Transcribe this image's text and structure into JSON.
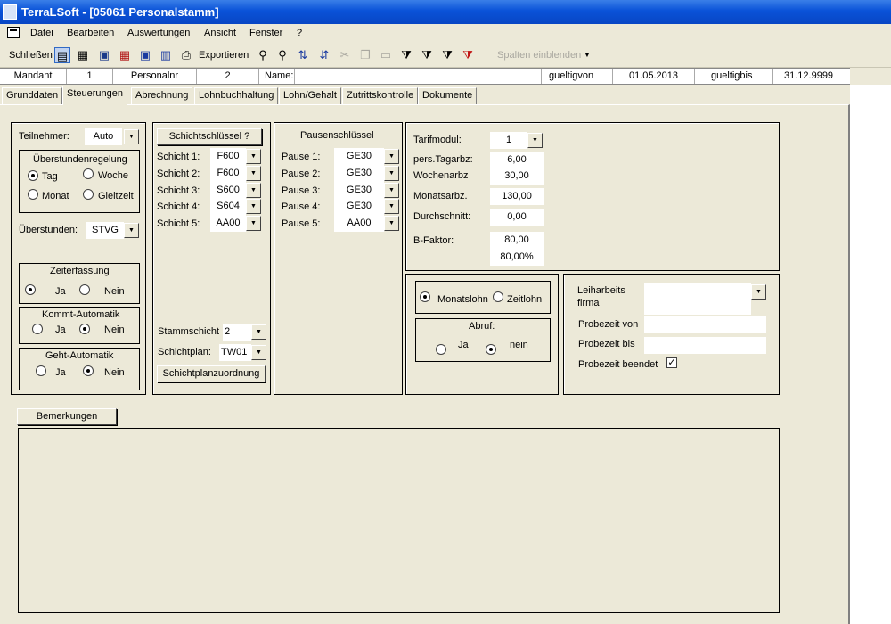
{
  "window": {
    "title": "TerraLSoft - [05061 Personalstamm]"
  },
  "menu": [
    "Datei",
    "Bearbeiten",
    "Auswertungen",
    "Ansicht",
    "Fenster",
    "?"
  ],
  "toolbar": {
    "close_label": "Schließen",
    "export_label": "Exportieren",
    "columns_label": "Spalten einblenden"
  },
  "header": {
    "mandant_label": "Mandant",
    "mandant_value": "1",
    "personalnr_label": "Personalnr",
    "personalnr_value": "2",
    "name_label": "Name:",
    "name_value": "",
    "gueltigvon_label": "gueltigvon",
    "gueltigvon_value": "01.05.2013",
    "gueltigbis_label": "gueltigbis",
    "gueltigbis_value": "31.12.9999"
  },
  "tabs": [
    "Grunddaten",
    "Steuerungen",
    "Abrechnung",
    "Lohnbuchhaltung",
    "Lohn/Gehalt",
    "Zutrittskontrolle",
    "Dokumente"
  ],
  "active_tab": "Steuerungen",
  "left": {
    "teilnehmer_label": "Teilnehmer:",
    "teilnehmer_value": "Auto",
    "ueberstundenregelung_title": "Überstundenregelung",
    "radio_tag": "Tag",
    "radio_woche": "Woche",
    "radio_monat": "Monat",
    "radio_gleitzeit": "Gleitzeit",
    "ueberstunden_label": "Überstunden:",
    "ueberstunden_value": "STVG",
    "zeiterfassung_title": "Zeiterfassung",
    "kommt_title": "Kommt-Automatik",
    "geht_title": "Geht-Automatik",
    "ja": "Ja",
    "nein": "Nein"
  },
  "schicht": {
    "button": "Schichtschlüssel ?",
    "rows": [
      {
        "label": "Schicht 1:",
        "value": "F600"
      },
      {
        "label": "Schicht 2:",
        "value": "F600"
      },
      {
        "label": "Schicht 3:",
        "value": "S600"
      },
      {
        "label": "Schicht 4:",
        "value": "S604"
      },
      {
        "label": "Schicht 5:",
        "value": "AA00"
      }
    ],
    "stammschicht_label": "Stammschicht",
    "stammschicht_value": "2",
    "schichtplan_label": "Schichtplan:",
    "schichtplan_value": "TW01",
    "zuordnung_button": "Schichtplanzuordnung"
  },
  "pause": {
    "title": "Pausenschlüssel",
    "rows": [
      {
        "label": "Pause 1:",
        "value": "GE30"
      },
      {
        "label": "Pause 2:",
        "value": "GE30"
      },
      {
        "label": "Pause 3:",
        "value": "GE30"
      },
      {
        "label": "Pause 4:",
        "value": "GE30"
      },
      {
        "label": "Pause 5:",
        "value": "AA00"
      }
    ]
  },
  "tarif": {
    "tarifmodul_label": "Tarifmodul:",
    "tarifmodul_value": "1",
    "tagarbz_label": "pers.Tagarbz:",
    "tagarbz_value": "6,00",
    "wochenarbz_label": "Wochenarbz",
    "wochenarbz_value": "30,00",
    "monatsarbz_label": "Monatsarbz.",
    "monatsarbz_value": "130,00",
    "durchschnitt_label": "Durchschnitt:",
    "durchschnitt_value": "0,00",
    "bfaktor_label": "B-Faktor:",
    "bfaktor_value1": "80,00",
    "bfaktor_value2": "80,00%"
  },
  "lohn": {
    "monatslohn": "Monatslohn",
    "zeitlohn": "Zeitlohn",
    "abruf_title": "Abruf:",
    "ja": "Ja",
    "nein": "nein"
  },
  "leih": {
    "firma_label1": "Leiharbeits",
    "firma_label2": "firma",
    "probezeit_von_label": "Probezeit von",
    "probezeit_bis_label": "Probezeit bis",
    "probezeit_beendet_label": "Probezeit beendet",
    "checkmark": "✓"
  },
  "bemerkungen_button": "Bemerkungen"
}
